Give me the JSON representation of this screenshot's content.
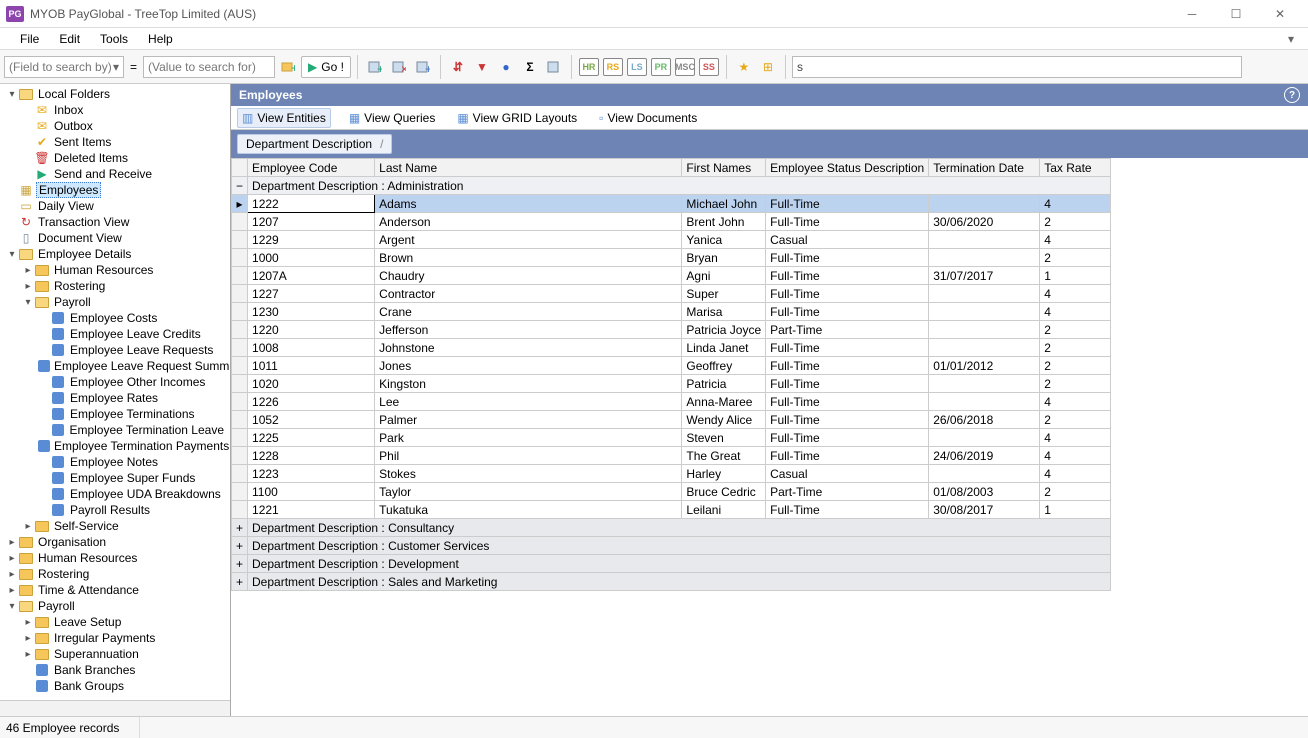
{
  "window": {
    "logo": "PG",
    "title": "MYOB PayGlobal - TreeTop Limited (AUS)"
  },
  "menu": [
    "File",
    "Edit",
    "Tools",
    "Help"
  ],
  "search": {
    "field_placeholder": "(Field to search by)",
    "value_placeholder": "(Value to search for)",
    "eq": "=",
    "go": "Go !",
    "typed": "s"
  },
  "badges": [
    "HR",
    "RS",
    "LS",
    "PR",
    "MSC",
    "SS"
  ],
  "tree": [
    {
      "d": 0,
      "tw": "-",
      "ic": "folder-open",
      "lbl": "Local Folders"
    },
    {
      "d": 1,
      "tw": "",
      "ic": "mail",
      "lbl": "Inbox"
    },
    {
      "d": 1,
      "tw": "",
      "ic": "mail",
      "lbl": "Outbox"
    },
    {
      "d": 1,
      "tw": "",
      "ic": "check",
      "lbl": "Sent Items"
    },
    {
      "d": 1,
      "tw": "",
      "ic": "trash",
      "lbl": "Deleted Items"
    },
    {
      "d": 1,
      "tw": "",
      "ic": "play",
      "lbl": "Send and Receive"
    },
    {
      "d": 0,
      "tw": "",
      "ic": "grid",
      "lbl": "Employees",
      "sel": true
    },
    {
      "d": 0,
      "tw": "",
      "ic": "cal",
      "lbl": "Daily View"
    },
    {
      "d": 0,
      "tw": "",
      "ic": "refresh",
      "lbl": "Transaction View"
    },
    {
      "d": 0,
      "tw": "",
      "ic": "doc",
      "lbl": "Document View"
    },
    {
      "d": 0,
      "tw": "-",
      "ic": "folder-open",
      "lbl": "Employee Details"
    },
    {
      "d": 1,
      "tw": ">",
      "ic": "folder",
      "lbl": "Human Resources"
    },
    {
      "d": 1,
      "tw": ">",
      "ic": "folder",
      "lbl": "Rostering"
    },
    {
      "d": 1,
      "tw": "-",
      "ic": "folder-open",
      "lbl": "Payroll"
    },
    {
      "d": 2,
      "tw": "",
      "ic": "blue",
      "lbl": "Employee Costs"
    },
    {
      "d": 2,
      "tw": "",
      "ic": "blue",
      "lbl": "Employee Leave Credits"
    },
    {
      "d": 2,
      "tw": "",
      "ic": "blue",
      "lbl": "Employee Leave Requests"
    },
    {
      "d": 2,
      "tw": "",
      "ic": "blue",
      "lbl": "Employee Leave Request Summary"
    },
    {
      "d": 2,
      "tw": "",
      "ic": "blue",
      "lbl": "Employee Other Incomes"
    },
    {
      "d": 2,
      "tw": "",
      "ic": "blue",
      "lbl": "Employee Rates"
    },
    {
      "d": 2,
      "tw": "",
      "ic": "blue",
      "lbl": "Employee Terminations"
    },
    {
      "d": 2,
      "tw": "",
      "ic": "blue",
      "lbl": "Employee Termination Leave"
    },
    {
      "d": 2,
      "tw": "",
      "ic": "blue",
      "lbl": "Employee Termination Payments"
    },
    {
      "d": 2,
      "tw": "",
      "ic": "blue",
      "lbl": "Employee Notes"
    },
    {
      "d": 2,
      "tw": "",
      "ic": "blue",
      "lbl": "Employee Super Funds"
    },
    {
      "d": 2,
      "tw": "",
      "ic": "blue",
      "lbl": "Employee UDA Breakdowns"
    },
    {
      "d": 2,
      "tw": "",
      "ic": "blue",
      "lbl": "Payroll Results"
    },
    {
      "d": 1,
      "tw": ">",
      "ic": "folder",
      "lbl": "Self-Service"
    },
    {
      "d": 0,
      "tw": ">",
      "ic": "folder",
      "lbl": "Organisation"
    },
    {
      "d": 0,
      "tw": ">",
      "ic": "folder",
      "lbl": "Human Resources"
    },
    {
      "d": 0,
      "tw": ">",
      "ic": "folder",
      "lbl": "Rostering"
    },
    {
      "d": 0,
      "tw": ">",
      "ic": "folder",
      "lbl": "Time & Attendance"
    },
    {
      "d": 0,
      "tw": "-",
      "ic": "folder-open",
      "lbl": "Payroll"
    },
    {
      "d": 1,
      "tw": ">",
      "ic": "folder",
      "lbl": "Leave Setup"
    },
    {
      "d": 1,
      "tw": ">",
      "ic": "folder",
      "lbl": "Irregular Payments"
    },
    {
      "d": 1,
      "tw": ">",
      "ic": "folder",
      "lbl": "Superannuation"
    },
    {
      "d": 1,
      "tw": "",
      "ic": "blue",
      "lbl": "Bank Branches"
    },
    {
      "d": 1,
      "tw": "",
      "ic": "blue",
      "lbl": "Bank Groups"
    }
  ],
  "panel": {
    "title": "Employees",
    "tabs": [
      "View Entities",
      "View Queries",
      "View GRID Layouts",
      "View Documents"
    ],
    "group_by": "Department Description",
    "slash": "/"
  },
  "columns": [
    "Employee Code",
    "Last Name",
    "First Names",
    "Employee Status Description",
    "Termination Date",
    "Tax Rate"
  ],
  "group_header": "Department Description : Administration",
  "rows": [
    {
      "code": "1222",
      "last": "Adams",
      "first": "Michael John",
      "status": "Full-Time",
      "term": "",
      "tax": "4",
      "sel": true
    },
    {
      "code": "1207",
      "last": "Anderson",
      "first": "Brent John",
      "status": "Full-Time",
      "term": "30/06/2020",
      "tax": "2"
    },
    {
      "code": "1229",
      "last": "Argent",
      "first": "Yanica",
      "status": "Casual",
      "term": "",
      "tax": "4"
    },
    {
      "code": "1000",
      "last": "Brown",
      "first": "Bryan",
      "status": "Full-Time",
      "term": "",
      "tax": "2"
    },
    {
      "code": "1207A",
      "last": "Chaudry",
      "first": "Agni",
      "status": "Full-Time",
      "term": "31/07/2017",
      "tax": "1"
    },
    {
      "code": "1227",
      "last": "Contractor",
      "first": "Super",
      "status": "Full-Time",
      "term": "",
      "tax": "4"
    },
    {
      "code": "1230",
      "last": "Crane",
      "first": "Marisa",
      "status": "Full-Time",
      "term": "",
      "tax": "4"
    },
    {
      "code": "1220",
      "last": "Jefferson",
      "first": "Patricia Joyce",
      "status": "Part-Time",
      "term": "",
      "tax": "2"
    },
    {
      "code": "1008",
      "last": "Johnstone",
      "first": "Linda Janet",
      "status": "Full-Time",
      "term": "",
      "tax": "2"
    },
    {
      "code": "1011",
      "last": "Jones",
      "first": "Geoffrey",
      "status": "Full-Time",
      "term": "01/01/2012",
      "tax": "2"
    },
    {
      "code": "1020",
      "last": "Kingston",
      "first": "Patricia",
      "status": "Full-Time",
      "term": "",
      "tax": "2"
    },
    {
      "code": "1226",
      "last": "Lee",
      "first": "Anna-Maree",
      "status": "Full-Time",
      "term": "",
      "tax": "4"
    },
    {
      "code": "1052",
      "last": "Palmer",
      "first": "Wendy Alice",
      "status": "Full-Time",
      "term": "26/06/2018",
      "tax": "2"
    },
    {
      "code": "1225",
      "last": "Park",
      "first": "Steven",
      "status": "Full-Time",
      "term": "",
      "tax": "4"
    },
    {
      "code": "1228",
      "last": "Phil",
      "first": "The Great",
      "status": "Full-Time",
      "term": "24/06/2019",
      "tax": "4"
    },
    {
      "code": "1223",
      "last": "Stokes",
      "first": "Harley",
      "status": "Casual",
      "term": "",
      "tax": "4"
    },
    {
      "code": "1100",
      "last": "Taylor",
      "first": "Bruce Cedric",
      "status": "Part-Time",
      "term": "01/08/2003",
      "tax": "2"
    },
    {
      "code": "1221",
      "last": "Tukatuka",
      "first": "Leilani",
      "status": "Full-Time",
      "term": "30/08/2017",
      "tax": "1"
    }
  ],
  "collapsed_groups": [
    "Department Description : Consultancy",
    "Department Description : Customer Services",
    "Department Description : Development",
    "Department Description : Sales and Marketing"
  ],
  "status": "46 Employee records"
}
